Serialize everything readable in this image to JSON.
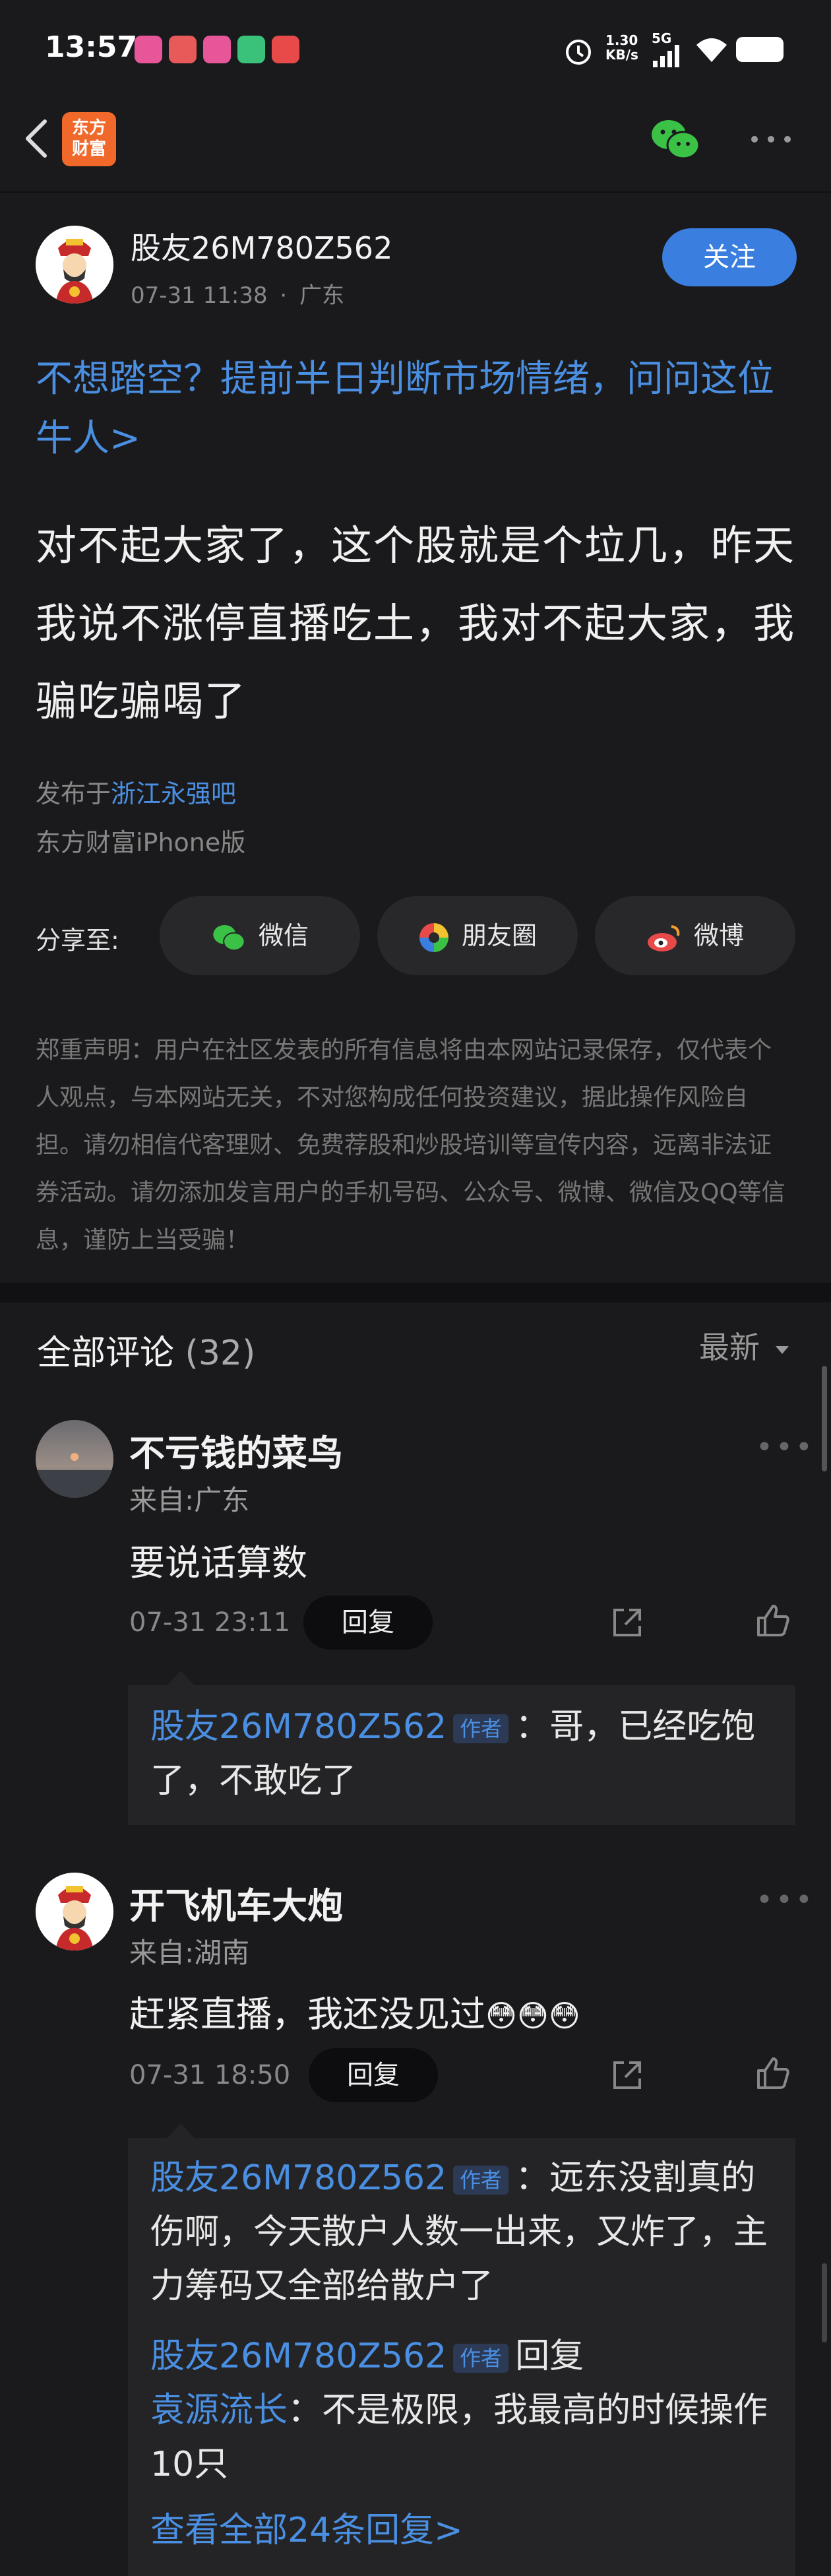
{
  "status_bar": {
    "time": "13:57",
    "network_speed": "1.30\nKB/s",
    "network_type": "5G"
  },
  "nav": {
    "logo_text_1": "东方",
    "logo_text_2": "财富"
  },
  "post": {
    "username": "股友26M780Z562",
    "time": "07-31 11:38",
    "location": "广东",
    "follow_label": "关注",
    "promo_link": "不想踏空？提前半日判断市场情绪，问问这位牛人>",
    "body": "对不起大家了，这个股就是个垃几，昨天我说不涨停直播吃土，我对不起大家，我骗吃骗喝了",
    "published_prefix": "发布于",
    "published_bar": "浙江永强吧",
    "client": "东方财富iPhone版",
    "share_label": "分享至:",
    "share_buttons": [
      "微信",
      "朋友圈",
      "微博"
    ],
    "disclaimer": "郑重声明：用户在社区发表的所有信息将由本网站记录保存，仅代表个人观点，与本网站无关，不对您构成任何投资建议，据此操作风险自担。请勿相信代客理财、免费荐股和炒股培训等宣传内容，远离非法证券活动。请勿添加发言用户的手机号码、公众号、微博、微信及QQ等信息，谨防上当受骗！"
  },
  "comments": {
    "title": "全部评论",
    "count": "(32)",
    "sort": "最新",
    "items": [
      {
        "name": "不亏钱的菜鸟",
        "location": "来自:广东",
        "text": "要说话算数",
        "time": "07-31 23:11",
        "reply_label": "回复",
        "replies": [
          {
            "user": "股友26M780Z562",
            "tag": "作者",
            "text": "：哥，已经吃饱了，不敢吃了"
          }
        ]
      },
      {
        "name": "开飞机车大炮",
        "location": "来自:湖南",
        "text": "赶紧直播，我还没见过",
        "emoji": "😳😳😳",
        "time": "07-31 18:50",
        "reply_label": "回复",
        "replies": [
          {
            "user": "股友26M780Z562",
            "tag": "作者",
            "text": "：远东没割真的伤啊，今天散户人数一出来，又炸了，主力筹码又全部给散户了"
          },
          {
            "user": "股友26M780Z562",
            "tag": "作者",
            "mid": "回复",
            "target": "袁源流长",
            "text": "：不是极限，我最高的时候操作10只"
          }
        ],
        "view_all": "查看全部24条回复>"
      }
    ]
  },
  "colors": {
    "background": "#1a1a1c",
    "accent_blue": "#3a7fe0",
    "link_blue": "#4a8fe2",
    "brand_orange": "#f0692a"
  }
}
